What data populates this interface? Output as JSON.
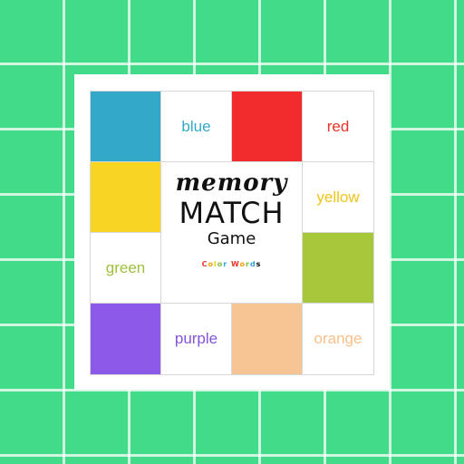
{
  "title": {
    "line1": "memory",
    "line2": "MATCH",
    "line3": "Game",
    "brand": "Color Words"
  },
  "cards": [
    {
      "id": "r1c1",
      "kind": "swatch",
      "color": "#34a8c9"
    },
    {
      "id": "r1c2",
      "kind": "word",
      "text": "blue",
      "color": "#34a8c9"
    },
    {
      "id": "r1c3",
      "kind": "swatch",
      "color": "#f22c2c"
    },
    {
      "id": "r1c4",
      "kind": "word",
      "text": "red",
      "color": "#e8332a"
    },
    {
      "id": "r2c1",
      "kind": "swatch",
      "color": "#f9d523"
    },
    {
      "id": "r2c4",
      "kind": "word",
      "text": "yellow",
      "color": "#f0c419"
    },
    {
      "id": "r3c1",
      "kind": "word",
      "text": "green",
      "color": "#9cc13a"
    },
    {
      "id": "r3c4",
      "kind": "swatch",
      "color": "#a6c83a"
    },
    {
      "id": "r4c1",
      "kind": "swatch",
      "color": "#8c5ae8"
    },
    {
      "id": "r4c2",
      "kind": "word",
      "text": "purple",
      "color": "#8654d8"
    },
    {
      "id": "r4c3",
      "kind": "swatch",
      "color": "#f7c594"
    },
    {
      "id": "r4c4",
      "kind": "word",
      "text": "orange",
      "color": "#f7c08a"
    }
  ]
}
